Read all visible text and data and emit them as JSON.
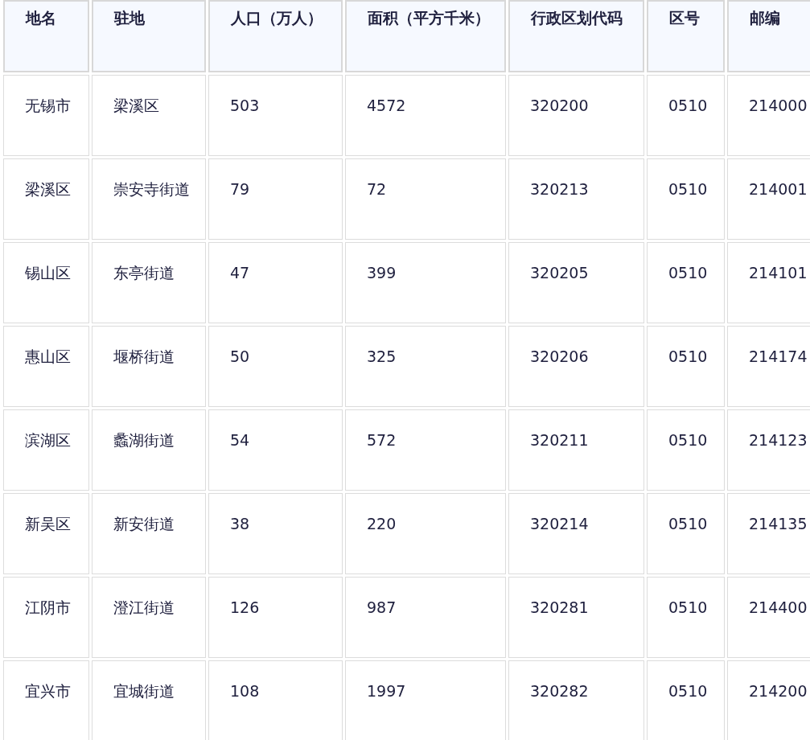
{
  "table": {
    "columns": [
      "地名",
      "驻地",
      "人口（万人）",
      "面积（平方千米）",
      "行政区划代码",
      "区号",
      "邮编"
    ],
    "rows": [
      [
        "无锡市",
        "梁溪区",
        "503",
        "4572",
        "320200",
        "0510",
        "214000"
      ],
      [
        "梁溪区",
        "崇安寺街道",
        "79",
        "72",
        "320213",
        "0510",
        "214001"
      ],
      [
        "锡山区",
        "东亭街道",
        "47",
        "399",
        "320205",
        "0510",
        "214101"
      ],
      [
        "惠山区",
        "堰桥街道",
        "50",
        "325",
        "320206",
        "0510",
        "214174"
      ],
      [
        "滨湖区",
        "蠡湖街道",
        "54",
        "572",
        "320211",
        "0510",
        "214123"
      ],
      [
        "新吴区",
        "新安街道",
        "38",
        "220",
        "320214",
        "0510",
        "214135"
      ],
      [
        "江阴市",
        "澄江街道",
        "126",
        "987",
        "320281",
        "0510",
        "214400"
      ],
      [
        "宜兴市",
        "宜城街道",
        "108",
        "1997",
        "320282",
        "0510",
        "214200"
      ]
    ]
  }
}
